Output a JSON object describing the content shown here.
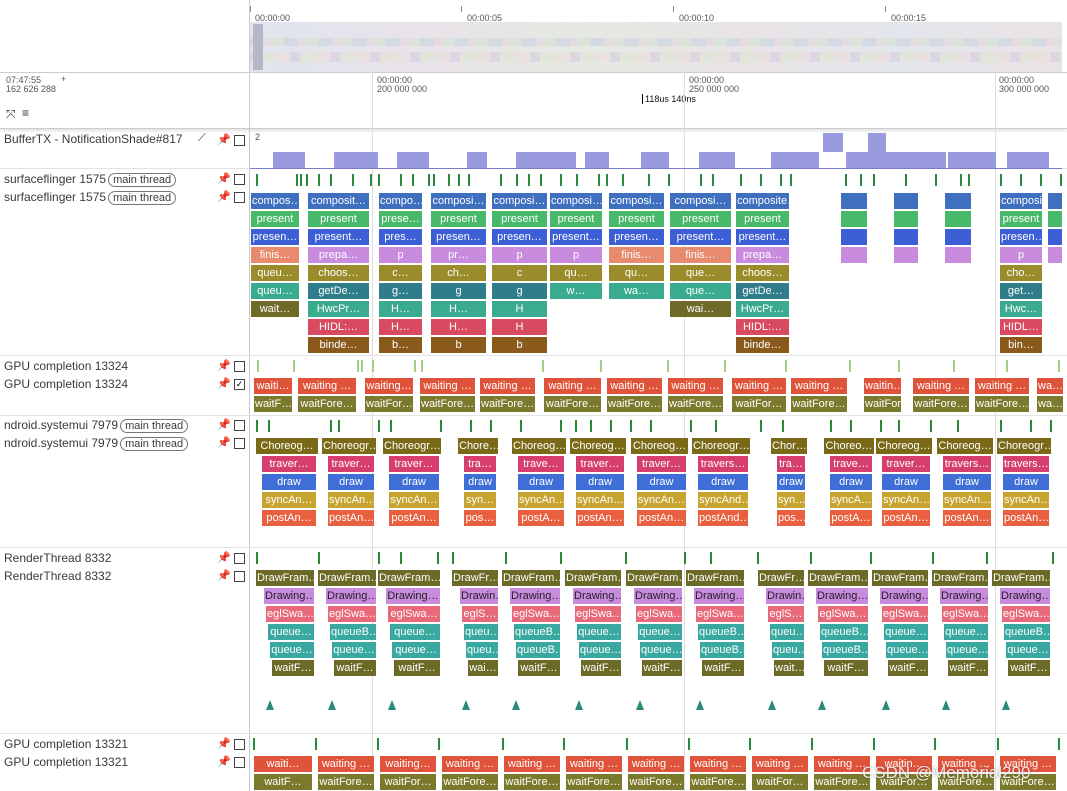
{
  "overview": {
    "ticks": [
      "00:00:00",
      "00:00:05",
      "00:00:10",
      "00:00:15"
    ]
  },
  "timeline": {
    "clock": "07:47:55",
    "offset": "162 626 288",
    "plus": "+",
    "ticks": [
      {
        "t": "00:00:00",
        "ns": "200 000 000"
      },
      {
        "t": "00:00:00",
        "ns": "250 000 000"
      },
      {
        "t": "00:00:00",
        "ns": "300 000 000"
      }
    ],
    "cursor_label": "118us 140ns"
  },
  "tracks": {
    "buffertx": {
      "name": "BufferTX - NotificationShade#817",
      "max": "2"
    },
    "sf_state": {
      "name": "surfaceflinger 1575",
      "tag": "main thread"
    },
    "sf_main": {
      "name": "surfaceflinger 1575",
      "tag": "main thread"
    },
    "gpu1_state": {
      "name": "GPU completion 13324"
    },
    "gpu1": {
      "name": "GPU completion 13324"
    },
    "sysui_state": {
      "name": "ndroid.systemui 7979",
      "tag": "main thread"
    },
    "sysui": {
      "name": "ndroid.systemui 7979",
      "tag": "main thread"
    },
    "rt_state": {
      "name": "RenderThread 8332"
    },
    "rt": {
      "name": "RenderThread 8332"
    },
    "gpu2_state": {
      "name": "GPU completion 13321"
    },
    "gpu2": {
      "name": "GPU completion 13321"
    }
  },
  "sf_columns": [
    {
      "rows": [
        "compos…",
        "present",
        "presen…",
        "finis…",
        "queu…",
        "queu…",
        "wait…"
      ]
    },
    {
      "rows": [
        "composit…",
        "present",
        "present…",
        "prepa…",
        "choos…",
        "getDe…",
        "HwcPr…",
        "HIDL:…",
        "binde…"
      ]
    },
    {
      "rows": [
        "compo…",
        "prese…",
        "pres…",
        "p",
        "c…",
        "g…",
        "H…",
        "H…",
        "b…"
      ]
    },
    {
      "rows": [
        "composi…",
        "present",
        "presen…",
        "pr…",
        "ch…",
        "g",
        "H…",
        "H…",
        "b"
      ]
    },
    {
      "rows": [
        "composi…",
        "present",
        "presen…",
        "p",
        "c",
        "g",
        "H",
        "H",
        "b"
      ]
    },
    {
      "rows": [
        "composi…",
        "present",
        "present…",
        "p",
        "qu…",
        "w…"
      ]
    },
    {
      "rows": [
        "composi…",
        "present",
        "presen…",
        "finis…",
        "qu…",
        "wa…"
      ]
    },
    {
      "rows": [
        "composi…",
        "present",
        "present…",
        "finis…",
        "que…",
        "que…",
        "wai…"
      ]
    },
    {
      "rows": [
        "composite…",
        "present",
        "present…",
        "prepa…",
        "choos…",
        "getDe…",
        "HwcPr…",
        "HIDL:…",
        "binde…"
      ]
    },
    {
      "rows": [
        "composi…",
        "present",
        "presen…",
        "p",
        "cho…",
        "get…",
        "Hwc…",
        "HIDL…",
        "bin…"
      ]
    }
  ],
  "gpu_slices": {
    "top": [
      "waiti…",
      "waiting …",
      "waiting…",
      "waiting …",
      "waiting …",
      "waiting …",
      "waiting …",
      "waiting …",
      "waiting …",
      "waiting …",
      "waitin…",
      "waiting …",
      "waiting …",
      "wa…"
    ],
    "bottom": [
      "waitF…",
      "waitFore…",
      "waitFor…",
      "waitFore…",
      "waitFore…",
      "waitFore…",
      "waitFore…",
      "waitFore…",
      "waitFor…",
      "waitFore…",
      "waitFor…",
      "waitFore…",
      "waitFore…",
      "wa…"
    ]
  },
  "sysui_columns": [
    [
      "Choreog…",
      "traver…",
      "draw",
      "syncAn…",
      "postAn…"
    ],
    [
      "Choreogr…",
      "traver…",
      "draw",
      "syncAn…",
      "postAn…"
    ],
    [
      "Choreogr…",
      "traver…",
      "draw",
      "syncAn…",
      "postAn…"
    ],
    [
      "Chore…",
      "tra…",
      "draw",
      "syn…",
      "pos…"
    ],
    [
      "Choreog…",
      "trave…",
      "draw",
      "syncAn…",
      "postA…"
    ],
    [
      "Choreog…",
      "traver…",
      "draw",
      "syncAn…",
      "postAn…"
    ],
    [
      "Choreog…",
      "traver…",
      "draw",
      "syncAn…",
      "postAn…"
    ],
    [
      "Choreogr…",
      "travers…",
      "draw",
      "syncAnd…",
      "postAnd…"
    ],
    [
      "Chor…",
      "tra…",
      "draw",
      "syn…",
      "pos…"
    ],
    [
      "Choreo…",
      "trave…",
      "draw",
      "syncA…",
      "postA…"
    ],
    [
      "Choreog…",
      "traver…",
      "draw",
      "syncAn…",
      "postAn…"
    ],
    [
      "Choreog…",
      "travers…",
      "draw",
      "syncAn…",
      "postAn…"
    ],
    [
      "Choreogr…",
      "travers…",
      "draw",
      "syncAn…",
      "postAn…"
    ]
  ],
  "rt_columns": [
    [
      "DrawFram…",
      "Drawing…",
      "eglSwa…",
      "queue…",
      "queue…",
      "waitF…"
    ],
    [
      "DrawFram…",
      "Drawing…",
      "eglSwa…",
      "queueB…",
      "queue…",
      "waitF…"
    ],
    [
      "DrawFram…",
      "Drawing…",
      "eglSwa…",
      "queue…",
      "queue…",
      "waitF…"
    ],
    [
      "DrawFr…",
      "Drawin…",
      "eglS…",
      "queu…",
      "queu…",
      "wai…"
    ],
    [
      "DrawFram…",
      "Drawing…",
      "eglSwa…",
      "queueB…",
      "queueB…",
      "waitF…"
    ],
    [
      "DrawFram…",
      "Drawing…",
      "eglSwa…",
      "queue…",
      "queue…",
      "waitF…"
    ],
    [
      "DrawFram…",
      "Drawing…",
      "eglSwa…",
      "queue…",
      "queue…",
      "waitF…"
    ],
    [
      "DrawFram…",
      "Drawing…",
      "eglSwa…",
      "queueB…",
      "queueB…",
      "waitF…"
    ],
    [
      "DrawFr…",
      "Drawin…",
      "eglS…",
      "queu…",
      "queu…",
      "wait…"
    ],
    [
      "DrawFram…",
      "Drawing…",
      "eglSwa…",
      "queueB…",
      "queueB…",
      "waitF…"
    ],
    [
      "DrawFram…",
      "Drawing…",
      "eglSwa…",
      "queue…",
      "queue…",
      "waitF…"
    ],
    [
      "DrawFram…",
      "Drawing…",
      "eglSwa…",
      "queue…",
      "queue…",
      "waitF…"
    ],
    [
      "DrawFram…",
      "Drawing…",
      "eglSwa…",
      "queueB…",
      "queue…",
      "waitF…"
    ]
  ],
  "watermark": "CSDN @Memorial290",
  "colors": {
    "compose": "#3f6fbf",
    "present": "#48b86a",
    "present2": "#3d5fd6",
    "finish": "#e88a6e",
    "queue": "#9a8c2a",
    "wait": "#6f6a28",
    "hidl": "#d84a5f",
    "binder": "#8a5a1c",
    "hwc": "#3aab8f",
    "choreo": "#7a6a18",
    "traverse": "#d63f6d",
    "draw": "#3f6fd6",
    "sync": "#c7a430",
    "post": "#e86040",
    "drawframe": "#6b6a26",
    "drawing": "#c98bde",
    "eglswap": "#e86a7a",
    "queueb": "#38a8a0",
    "gpu_wait": "#e0533b",
    "gpu_wait_for": "#7b7a2c",
    "buffertx": "#9a9ade"
  }
}
